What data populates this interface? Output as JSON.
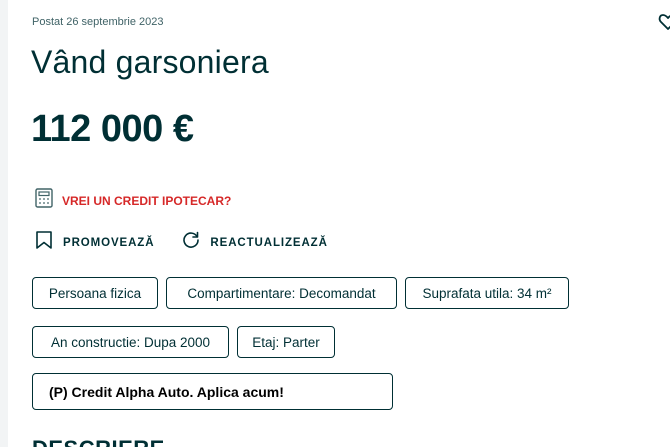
{
  "listing": {
    "posted": "Postat 26 septembrie 2023",
    "title": "Vând garsoniera",
    "price": "112 000 €"
  },
  "credit": {
    "label": "VREI UN CREDIT IPOTECAR?",
    "icon": "calculator-icon"
  },
  "actions": {
    "promote_label": "PROMOVEAZĂ",
    "promote_icon": "bookmark-icon",
    "refresh_label": "REACTUALIZEAZĂ",
    "refresh_icon": "refresh-icon"
  },
  "tags": [
    "Persoana fizica",
    "Compartimentare: Decomandat",
    "Suprafata utila: 34 m²",
    "An constructie: Dupa 2000",
    "Etaj: Parter"
  ],
  "promo": {
    "label": "(P) Credit Alpha Auto. Aplica acum!"
  },
  "description": {
    "heading": "DESCRIERE"
  },
  "colors": {
    "primary": "#002f34",
    "accent_red": "#d62828",
    "muted": "#406367"
  }
}
